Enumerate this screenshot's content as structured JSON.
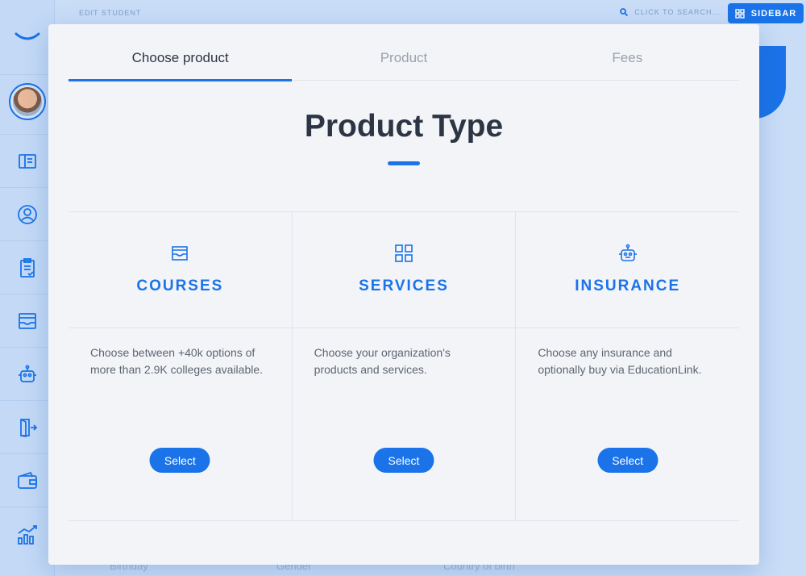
{
  "topbar": {
    "breadcrumb": "EDIT STUDENT",
    "search_placeholder": "CLICK TO SEARCH...",
    "sidebar_button": "SIDEBAR"
  },
  "sidebar": {
    "items": [
      {
        "icon": "book-icon"
      },
      {
        "icon": "user-circle-icon"
      },
      {
        "icon": "clipboard-check-icon"
      },
      {
        "icon": "inbox-icon"
      },
      {
        "icon": "robot-icon"
      },
      {
        "icon": "exit-door-icon"
      },
      {
        "icon": "wallet-icon"
      },
      {
        "icon": "chart-icon"
      }
    ]
  },
  "background_fields": [
    "Birthday",
    "Gender",
    "Country of birth"
  ],
  "modal": {
    "tabs": [
      {
        "label": "Choose product",
        "active": true
      },
      {
        "label": "Product",
        "active": false
      },
      {
        "label": "Fees",
        "active": false
      }
    ],
    "title": "Product Type",
    "options": [
      {
        "icon": "inbox-icon",
        "label": "COURSES",
        "description": "Choose between +40k options of more than 2.9K colleges available.",
        "button": "Select"
      },
      {
        "icon": "grid-icon",
        "label": "SERVICES",
        "description": "Choose your organization's products and services.",
        "button": "Select"
      },
      {
        "icon": "robot-icon",
        "label": "INSURANCE",
        "description": "Choose any insurance and optionally buy via EducationLink.",
        "button": "Select"
      }
    ]
  },
  "colors": {
    "accent": "#1a73e8",
    "text": "#2c3544",
    "muted": "#9aa2ad",
    "modal_bg": "#f3f4f8",
    "page_bg": "#c9ddf7"
  }
}
